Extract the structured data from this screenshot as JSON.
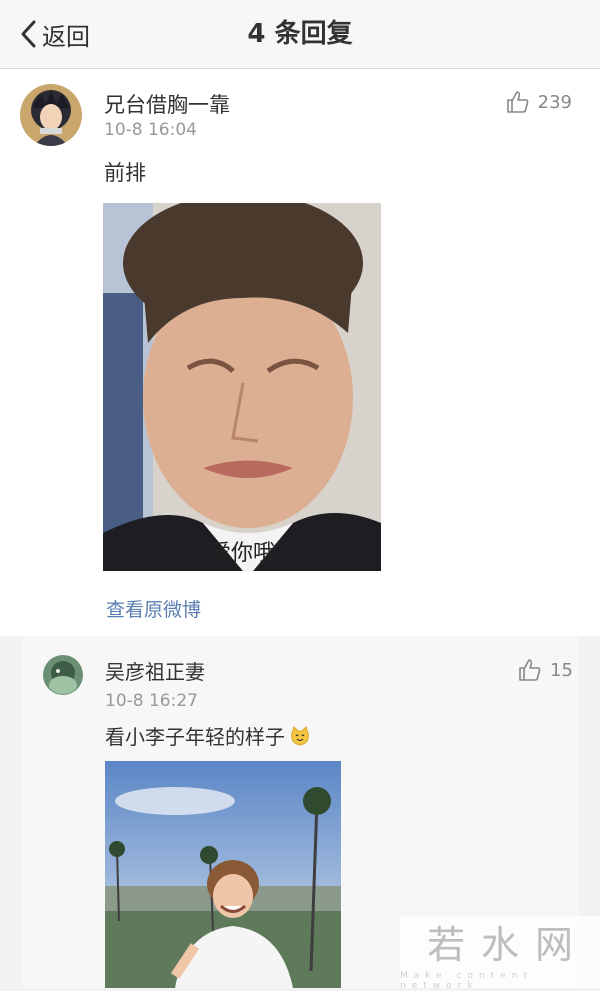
{
  "nav": {
    "back_label": "返回",
    "title": "4 条回复"
  },
  "comment": {
    "username": "兄台借胸一靠",
    "time": "10-8 16:04",
    "likes": "239",
    "text": "前排",
    "image_caption": "爱你哦",
    "view_original": "查看原微博"
  },
  "reply": {
    "username": "吴彦祖正妻",
    "time": "10-8 16:27",
    "likes": "15",
    "text": "看小李子年轻的样子"
  },
  "watermark": {
    "main": "若水网",
    "sub": "Make content network"
  },
  "colors": {
    "link": "#5b7fb0",
    "muted": "#999999",
    "card": "#f7f7f7"
  },
  "icons": [
    "chevron-left-icon",
    "thumbs-up-icon",
    "smiley-cat-emoji"
  ]
}
